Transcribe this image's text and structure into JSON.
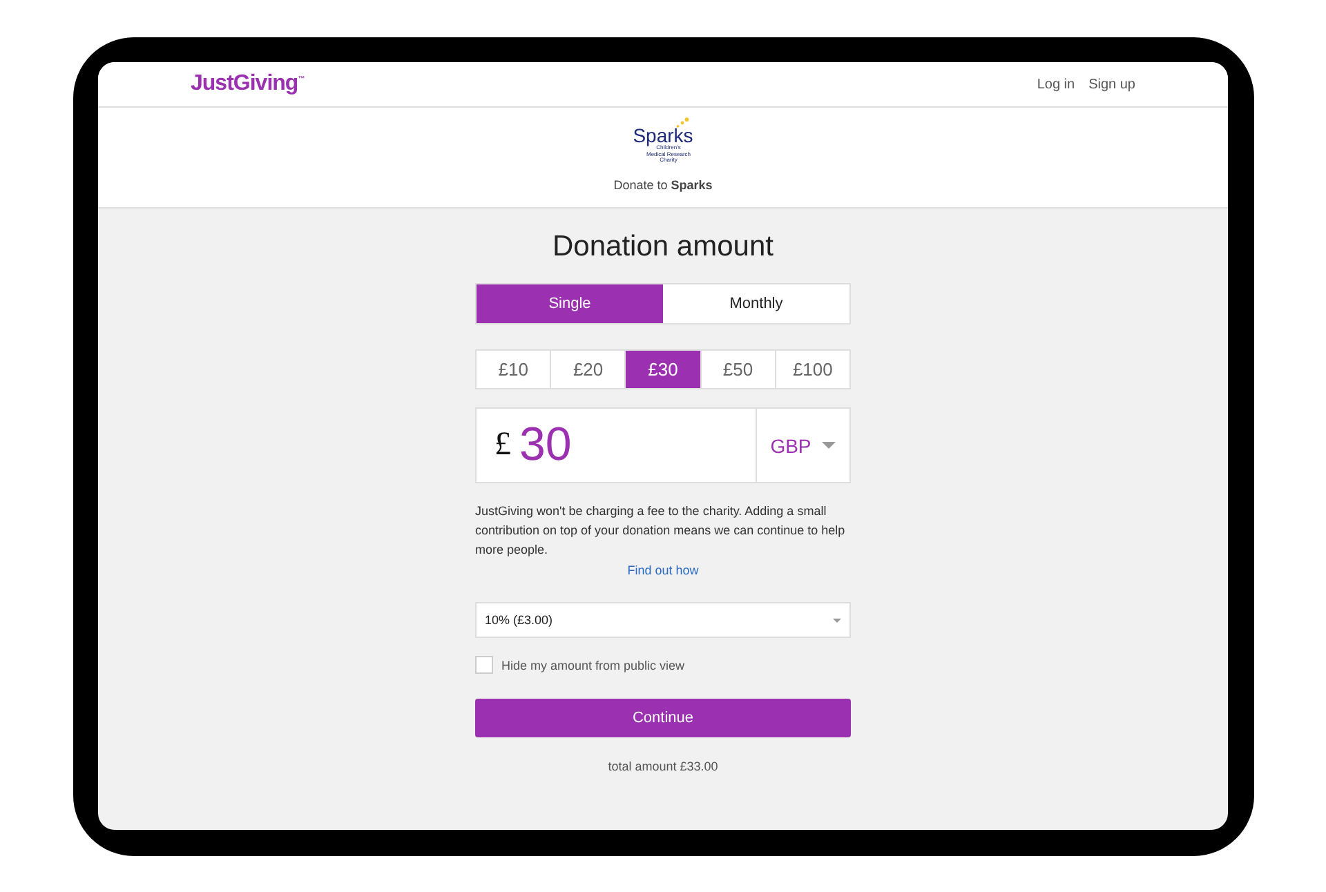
{
  "header": {
    "logo": "JustGiving$^{™}$",
    "links": [
      "Log in",
      "Sign up"
    ]
  },
  "charity": {
    "logo_name": "Sparks",
    "logo_tagline": "Children's Medical Research Charity",
    "donate_text": "Donate to **Sparks**"
  },
  "title": "Donation amount",
  "frequency_tabs": [
    {
      "label": "Single",
      "selected": true
    },
    {
      "label": "Monthly",
      "selected": false
    }
  ],
  "amounts": [
    {
      "label": "£10",
      "selected": false
    },
    {
      "label": "£20",
      "selected": false
    },
    {
      "label": "£30",
      "selected": true
    },
    {
      "label": "£50",
      "selected": false
    },
    {
      "label": "£100",
      "selected": false
    }
  ],
  "amount_field": {
    "symbol": "£",
    "value": "30",
    "currency": "GBP"
  },
  "note": "JustGiving won't be charging a fee to the charity. Adding a small contribution on top of your donation means we can continue to help more people.",
  "link": "Find out how",
  "fee_select": {
    "value": "10% (£3.00)"
  },
  "hide_amount": {
    "label": "Hide my amount from public view",
    "checked": false
  },
  "button": "Continue",
  "total": "total amount £33.00"
}
